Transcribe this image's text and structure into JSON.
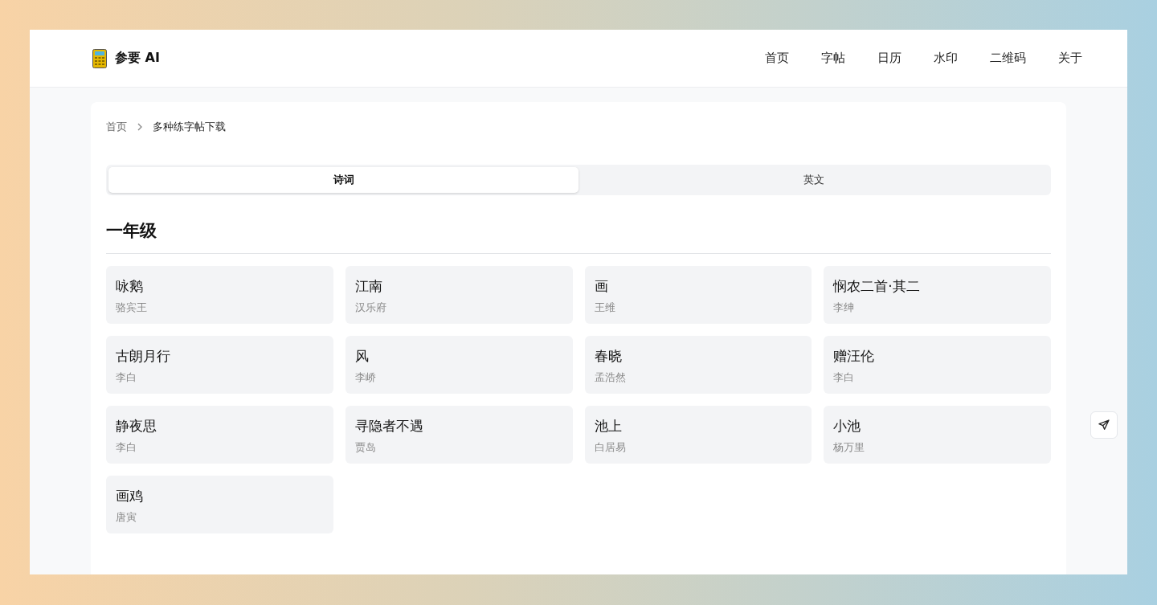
{
  "header": {
    "logo_text": "参要 AI",
    "nav": [
      {
        "label": "首页"
      },
      {
        "label": "字帖"
      },
      {
        "label": "日历"
      },
      {
        "label": "水印"
      },
      {
        "label": "二维码"
      },
      {
        "label": "关于"
      }
    ]
  },
  "breadcrumb": [
    {
      "label": "首页"
    },
    {
      "label": "多种练字帖下载"
    }
  ],
  "tabs": [
    {
      "label": "诗词",
      "selected": true
    },
    {
      "label": "英文",
      "selected": false
    }
  ],
  "sections": [
    {
      "title": "一年级",
      "poems": [
        {
          "title": "咏鹅",
          "author": "骆宾王"
        },
        {
          "title": "江南",
          "author": "汉乐府"
        },
        {
          "title": "画",
          "author": "王维"
        },
        {
          "title": "悯农二首·其二",
          "author": "李绅"
        },
        {
          "title": "古朗月行",
          "author": "李白"
        },
        {
          "title": "风",
          "author": "李峤"
        },
        {
          "title": "春晓",
          "author": "孟浩然"
        },
        {
          "title": "赠汪伦",
          "author": "李白"
        },
        {
          "title": "静夜思",
          "author": "李白"
        },
        {
          "title": "寻隐者不遇",
          "author": "贾岛"
        },
        {
          "title": "池上",
          "author": "白居易"
        },
        {
          "title": "小池",
          "author": "杨万里"
        },
        {
          "title": "画鸡",
          "author": "唐寅"
        }
      ]
    }
  ]
}
